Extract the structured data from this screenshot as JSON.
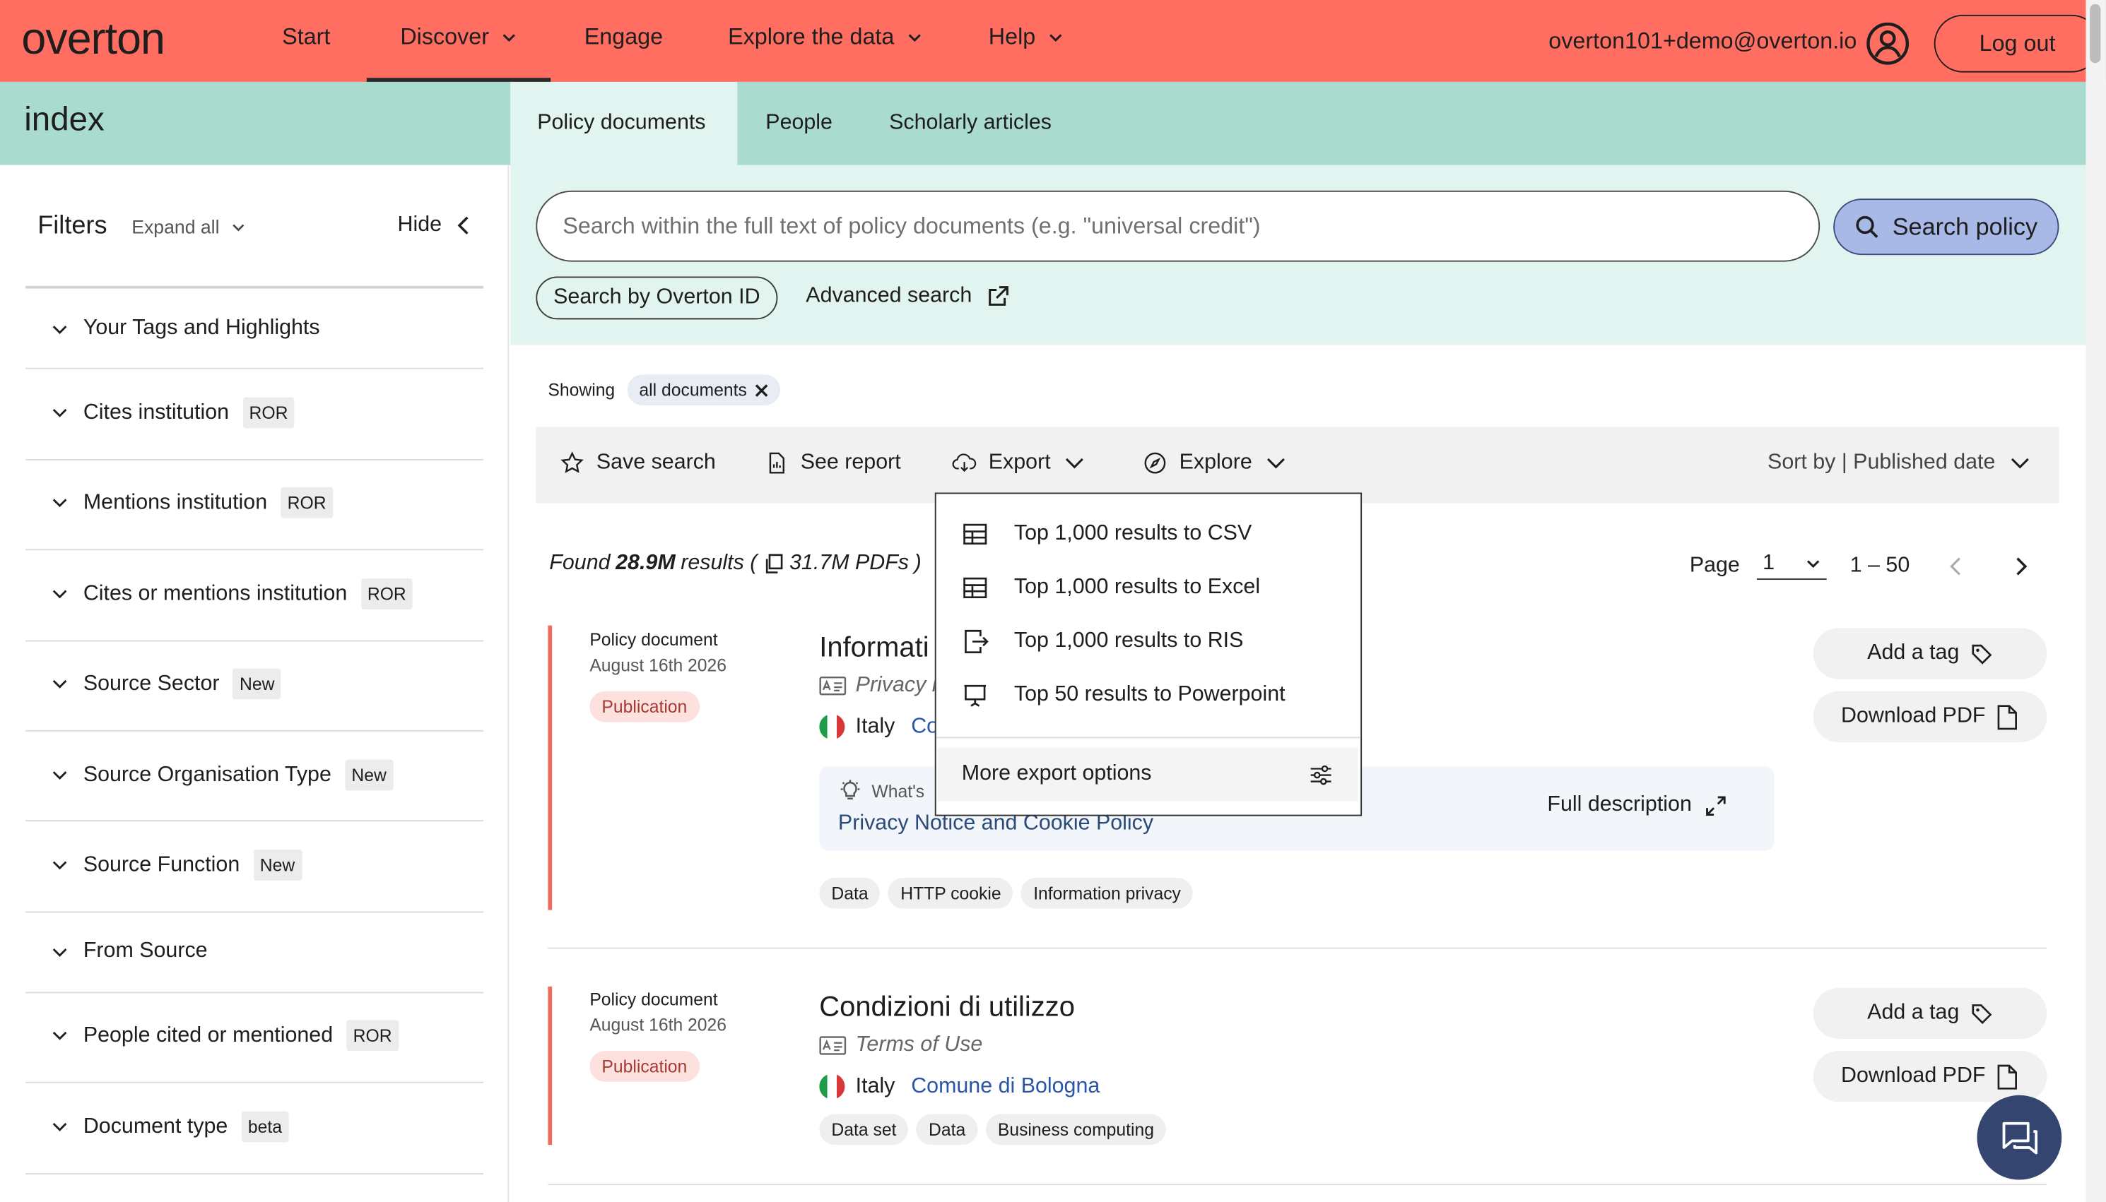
{
  "app": {
    "logo": "overton"
  },
  "nav": {
    "start": "Start",
    "discover": "Discover",
    "engage": "Engage",
    "explore_data": "Explore the data",
    "help": "Help",
    "email": "overton101+demo@overton.io",
    "logout": "Log out"
  },
  "index": {
    "label": "index",
    "tabs": [
      "Policy documents",
      "People",
      "Scholarly articles"
    ]
  },
  "filters": {
    "title": "Filters",
    "expand_all": "Expand all",
    "hide": "Hide",
    "items": [
      {
        "label": "Your Tags and Highlights",
        "badge": ""
      },
      {
        "label": "Cites institution",
        "badge": "ROR"
      },
      {
        "label": "Mentions institution",
        "badge": "ROR"
      },
      {
        "label": "Cites or mentions institution",
        "badge": "ROR"
      },
      {
        "label": "Source Sector",
        "badge": "New"
      },
      {
        "label": "Source Organisation Type",
        "badge": "New"
      },
      {
        "label": "Source Function",
        "badge": "New"
      },
      {
        "label": "From Source",
        "badge": ""
      },
      {
        "label": "People cited or mentioned",
        "badge": "ROR"
      },
      {
        "label": "Document type",
        "badge": "beta"
      }
    ]
  },
  "search": {
    "placeholder": "Search within the full text of policy documents (e.g. \"universal credit\")",
    "button": "Search policy",
    "overton_id": "Search by Overton ID",
    "advanced": "Advanced search"
  },
  "results_header": {
    "showing": "Showing",
    "chip": "all documents",
    "save_search": "Save search",
    "see_report": "See report",
    "export": "Export",
    "explore": "Explore",
    "sort_by": "Sort by | Published date",
    "found_prefix": "Found ",
    "found_count": "28.9M",
    "found_mid": " results (",
    "pdf_count": "31.7M PDFs",
    "found_end": " )",
    "page_label": "Page",
    "page_value": "1",
    "range": "1 – 50"
  },
  "export_menu": {
    "items": [
      "Top 1,000 results to CSV",
      "Top 1,000 results to Excel",
      "Top 1,000 results to RIS",
      "Top 50 results to Powerpoint"
    ],
    "more": "More export options"
  },
  "results": [
    {
      "type": "Policy document",
      "date": "August 16th 2026",
      "badge": "Publication",
      "title": "Informati",
      "subtitle": "Privacy i",
      "country": "Italy",
      "source": "Co",
      "desc_label": "What's",
      "desc_text": "Privacy Notice and Cookie Policy",
      "full_description": "Full description",
      "tags": [
        "Data",
        "HTTP cookie",
        "Information privacy"
      ],
      "add_tag": "Add a tag",
      "download": "Download PDF"
    },
    {
      "type": "Policy document",
      "date": "August 16th 2026",
      "badge": "Publication",
      "title": "Condizioni di utilizzo",
      "subtitle": "Terms of Use",
      "country": "Italy",
      "source": "Comune di Bologna",
      "tags": [
        "Data set",
        "Data",
        "Business computing"
      ],
      "add_tag": "Add a tag",
      "download": "Download PDF"
    }
  ],
  "colors": {
    "nav_bg": "#ff6e61",
    "index_bg": "#a9dccf",
    "search_bg": "#e2f4ef",
    "search_btn": "#a8b9e8",
    "accent_bar": "#f06a5e",
    "chat_btn": "#34456f"
  },
  "icons": [
    "user-icon",
    "search-icon",
    "external-link-icon",
    "star-icon",
    "report-icon",
    "export-icon",
    "compass-icon",
    "chevron-down-icon",
    "chevron-left-icon",
    "chevron-right-icon",
    "table-icon",
    "file-export-icon",
    "presentation-icon",
    "sliders-icon",
    "copy-icon",
    "translate-icon",
    "bulb-icon",
    "expand-icon",
    "tag-icon",
    "pdf-icon",
    "chat-icon"
  ]
}
